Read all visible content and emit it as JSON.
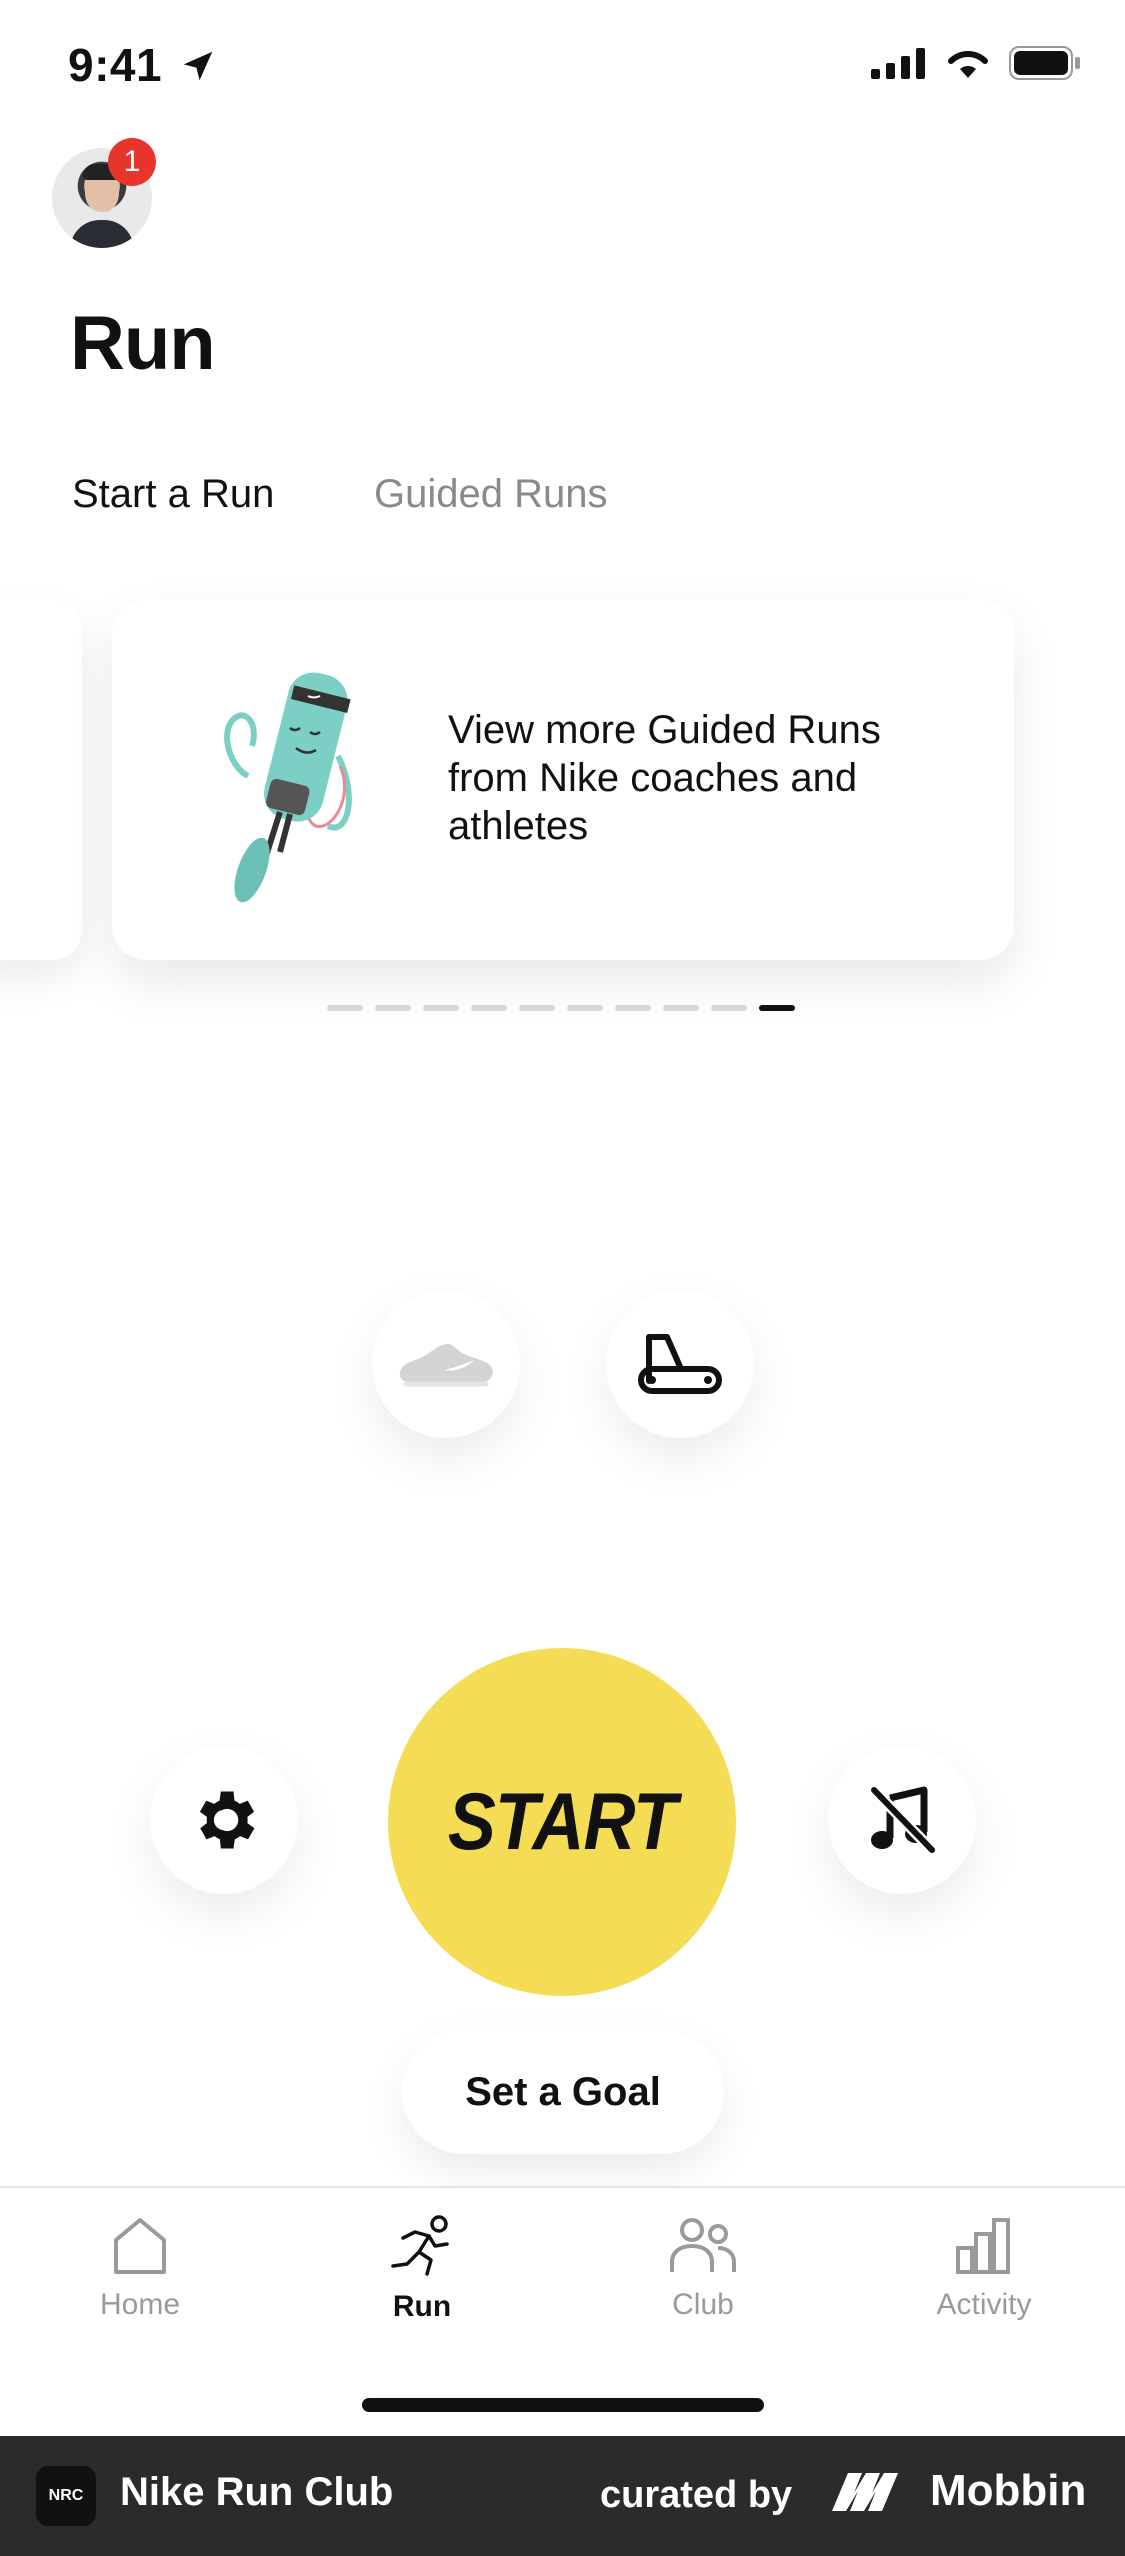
{
  "status_bar": {
    "time": "9:41"
  },
  "profile": {
    "badge_count": "1"
  },
  "page": {
    "title": "Run"
  },
  "tabs": [
    {
      "label": "Start a Run",
      "active": true
    },
    {
      "label": "Guided Runs",
      "active": false
    }
  ],
  "card": {
    "text": "View more Guided Runs from Nike coaches and athletes"
  },
  "pagination": {
    "total": 10,
    "active_index": 9
  },
  "controls": {
    "start_label": "START",
    "goal_label": "Set a Goal"
  },
  "bottom_nav": [
    {
      "label": "Home",
      "icon": "home-icon",
      "active": false
    },
    {
      "label": "Run",
      "icon": "runner-icon",
      "active": true
    },
    {
      "label": "Club",
      "icon": "people-icon",
      "active": false
    },
    {
      "label": "Activity",
      "icon": "bar-chart-icon",
      "active": false
    }
  ],
  "footer": {
    "app_name": "Nike Run Club",
    "app_icon_text": "NRC",
    "curated_by": "curated by",
    "brand": "Mobbin"
  },
  "colors": {
    "start_yellow": "#f5dc55",
    "badge_red": "#e8352b",
    "illustration_teal": "#7ccfc4"
  }
}
